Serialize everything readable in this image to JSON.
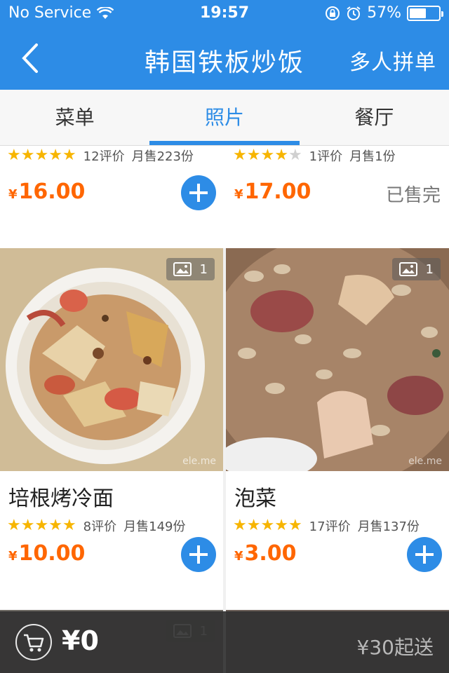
{
  "status_bar": {
    "carrier": "No Service",
    "time": "19:57",
    "battery": "57%",
    "battery_level": 0.57,
    "icons": [
      "wifi-icon",
      "rotation-lock-icon",
      "alarm-icon",
      "battery-icon"
    ]
  },
  "nav": {
    "back_icon": "chevron-left-icon",
    "title": "韩国铁板炒饭",
    "group_order": "多人拼单"
  },
  "tabs": [
    {
      "label": "菜单",
      "active": false
    },
    {
      "label": "照片",
      "active": true
    },
    {
      "label": "餐厅",
      "active": false
    }
  ],
  "items": [
    {
      "name": "",
      "rating": 5,
      "reviews": "12评价",
      "monthly_sales": "月售223份",
      "currency": "¥",
      "price": "16.00",
      "status": "add"
    },
    {
      "name": "",
      "rating": 4,
      "reviews": "1评价",
      "monthly_sales": "月售1份",
      "currency": "¥",
      "price": "17.00",
      "status": "已售完"
    },
    {
      "name": "培根烤冷面",
      "rating": 4.5,
      "reviews": "8评价",
      "monthly_sales": "月售149份",
      "currency": "¥",
      "price": "10.00",
      "status": "add",
      "photo_count": "1",
      "watermark": "ele.me"
    },
    {
      "name": "泡菜",
      "rating": 4.5,
      "reviews": "17评价",
      "monthly_sales": "月售137份",
      "currency": "¥",
      "price": "3.00",
      "status": "add",
      "photo_count": "1",
      "watermark": "ele.me"
    }
  ],
  "next_row": {
    "photo_count_left": "1"
  },
  "cart": {
    "icon": "shopping-cart-icon",
    "total": "¥0",
    "min_order": "¥30起送"
  },
  "colors": {
    "primary": "#2d8ce6",
    "price": "#ff6600",
    "star": "#f7b500"
  }
}
